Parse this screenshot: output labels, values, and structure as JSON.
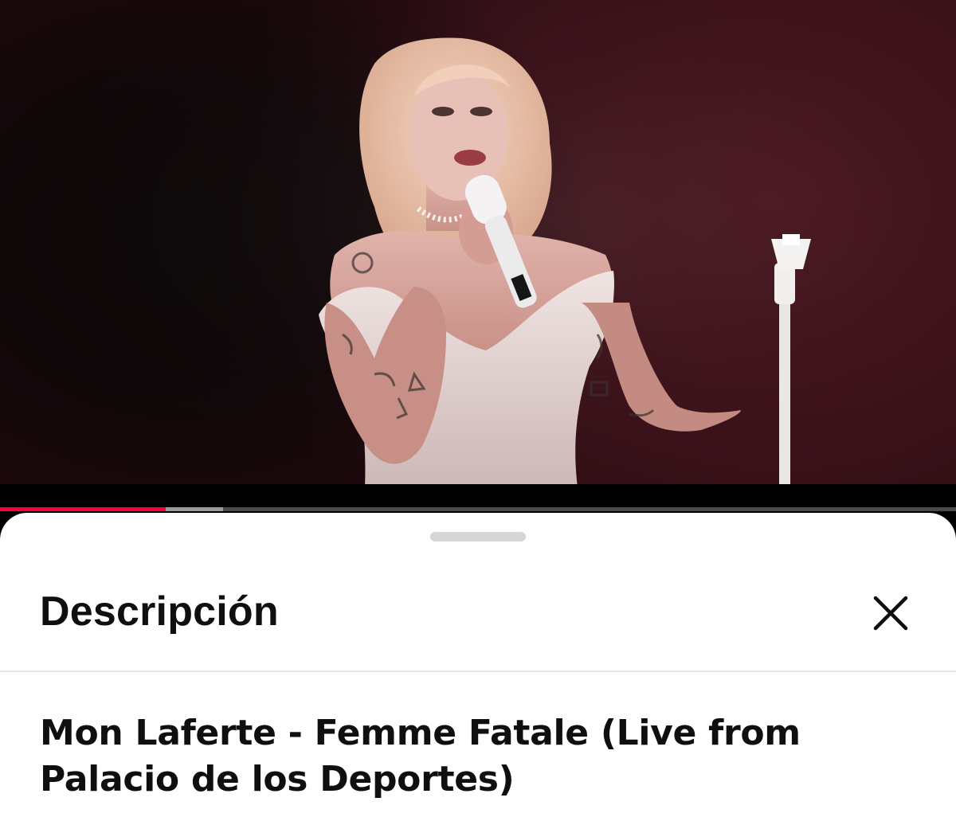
{
  "video": {
    "progress_played_fraction": 0.173,
    "progress_buffered_fraction": 0.233,
    "colors": {
      "played": "#ff0033",
      "buffered": "#9a9a9a",
      "track": "#4a4a4a"
    }
  },
  "sheet": {
    "title": "Descripción",
    "close_icon": "close-icon",
    "video_title": "Mon Laferte - Femme Fatale (Live from Palacio de los Deportes)"
  }
}
